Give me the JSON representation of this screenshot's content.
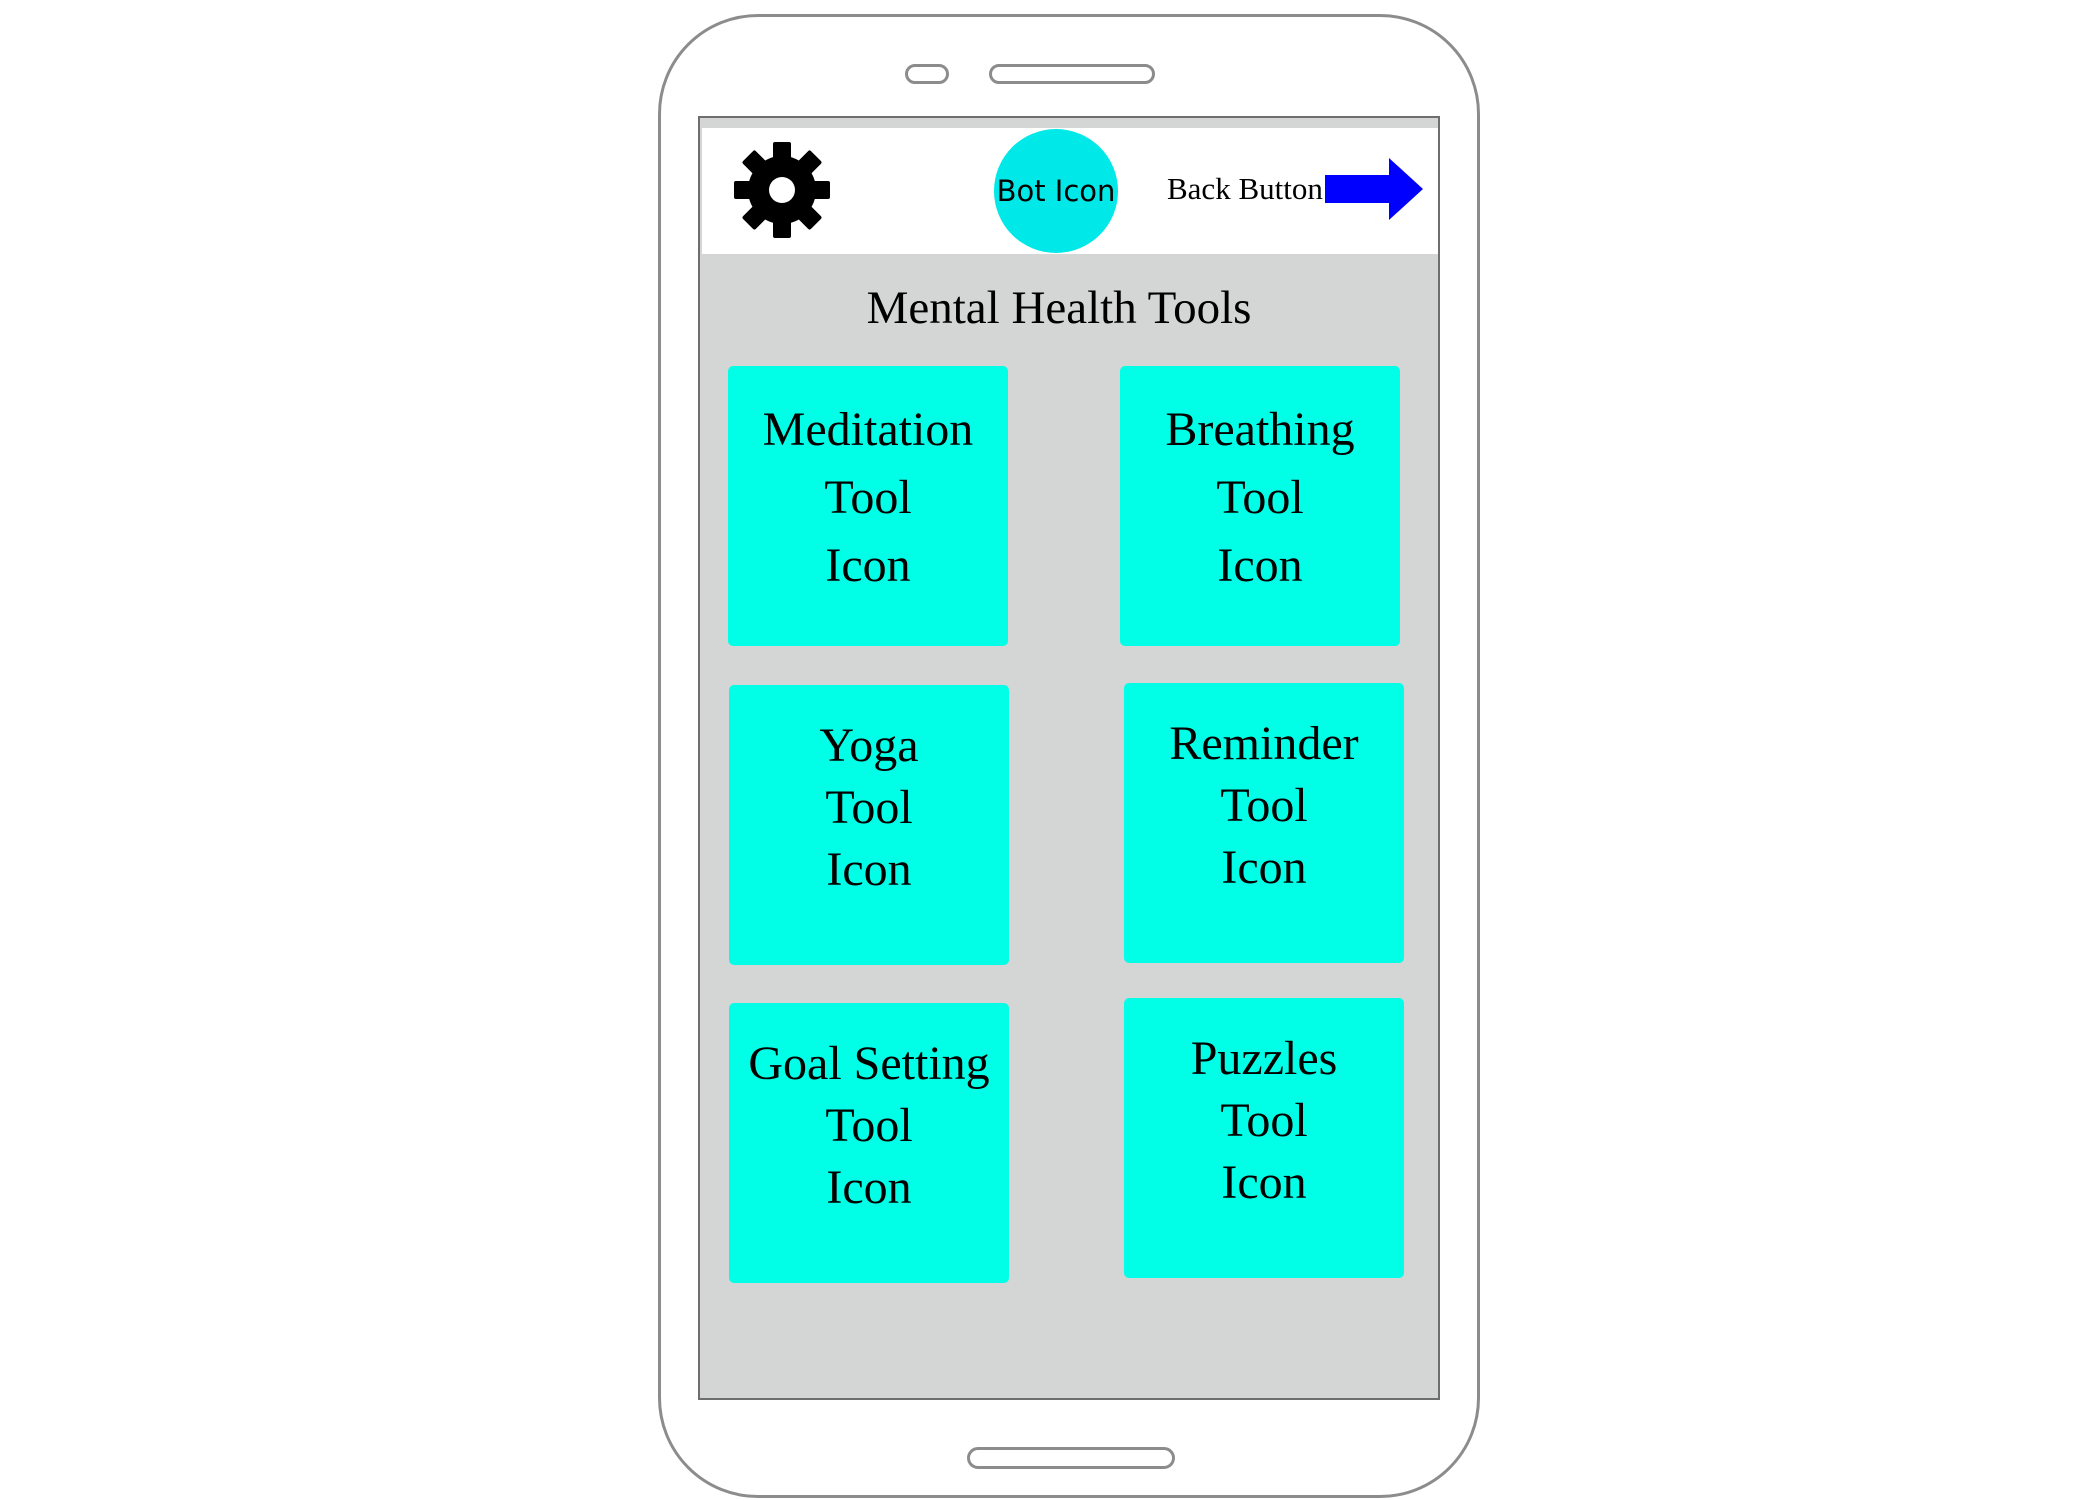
{
  "header": {
    "settings_icon": "gear-icon",
    "bot_label": "Bot Icon",
    "back_label": "Back Button",
    "back_icon": "right-arrow-icon"
  },
  "title": "Mental Health Tools",
  "tiles": [
    {
      "line1": "Meditation",
      "line2": "Tool",
      "line3": "Icon"
    },
    {
      "line1": "Breathing",
      "line2": "Tool",
      "line3": "Icon"
    },
    {
      "line1": "Yoga",
      "line2": "Tool",
      "line3": "Icon"
    },
    {
      "line1": "Reminder",
      "line2": "Tool",
      "line3": "Icon"
    },
    {
      "line1": "Goal Setting",
      "line2": "Tool",
      "line3": "Icon"
    },
    {
      "line1": "Puzzles",
      "line2": "Tool",
      "line3": "Icon"
    }
  ],
  "colors": {
    "accent": "#00ffe6",
    "bot": "#00e8e8",
    "arrow": "#0000ff",
    "screen_bg": "#d3d6d5"
  }
}
